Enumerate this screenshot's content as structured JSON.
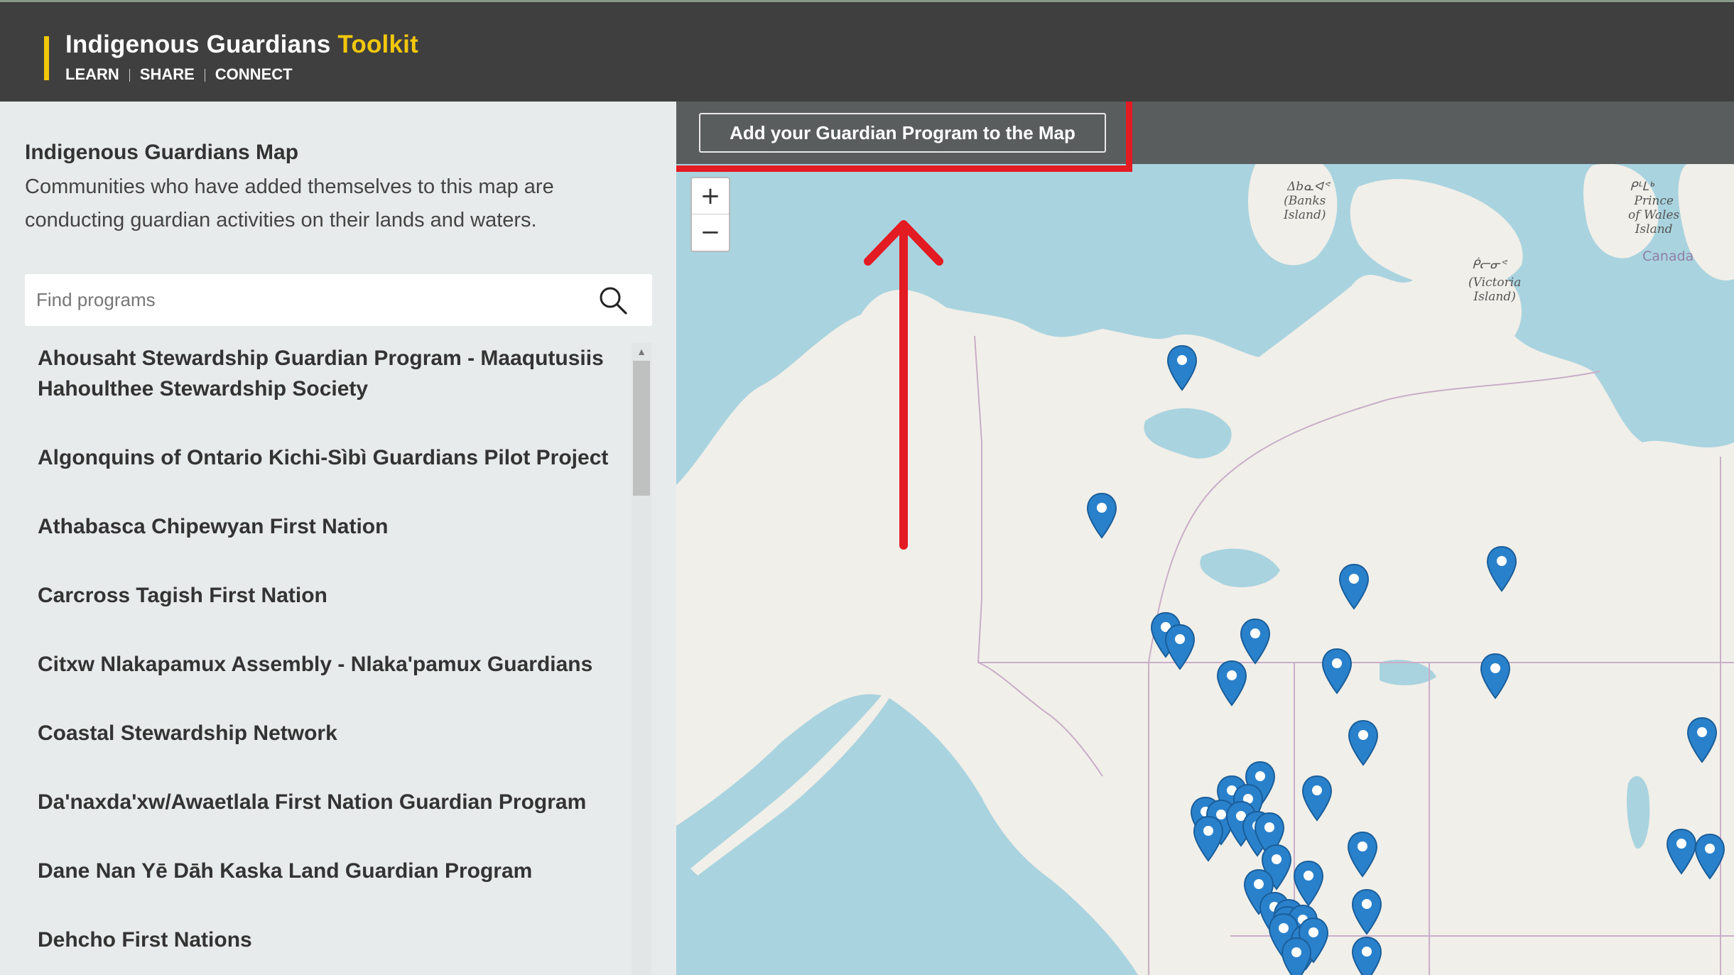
{
  "header": {
    "title_main": "Indigenous Guardians",
    "title_accent": "Toolkit",
    "nav": [
      "LEARN",
      "SHARE",
      "CONNECT"
    ]
  },
  "sidebar": {
    "title": "Indigenous Guardians Map",
    "description": "Communities who have added themselves to this map are conducting guardian activities on their lands and waters.",
    "search": {
      "placeholder": "Find programs",
      "value": ""
    },
    "programs": [
      "Ahousaht Stewardship Guardian Program - Maaqutusiis Hahoulthee Stewardship Society",
      "Algonquins of Ontario Kichi-Sìbì Guardians Pilot Project",
      "Athabasca Chipewyan First Nation",
      "Carcross Tagish First Nation",
      "Citxw Nlakapamux Assembly - Nlaka'pamux Guardians",
      "Coastal Stewardship Network",
      "Da'naxda'xw/Awaetlala First Nation Guardian Program",
      "Dane Nan Yē Dāh Kaska Land Guardian Program",
      "Dehcho First Nations"
    ]
  },
  "map": {
    "add_button_label": "Add your Guardian Program to the Map",
    "zoom_in": "+",
    "zoom_out": "−",
    "labels": {
      "banks_native": "Δbᓇᐊᕝ",
      "banks": "(Banks\nIsland)",
      "victoria_native": "ᑮᓕᓂᕝ",
      "victoria": "(Victoria\nIsland)",
      "prince_native": "ᑭᒻᒪᒃ",
      "prince": "Prince\nof Wales\nIsland",
      "country": "Canada"
    },
    "colors": {
      "water": "#a9d3df",
      "land": "#f1efe9",
      "marker": "#2a81cb",
      "highlight": "#e31b23",
      "accent": "#f2c70c"
    }
  }
}
